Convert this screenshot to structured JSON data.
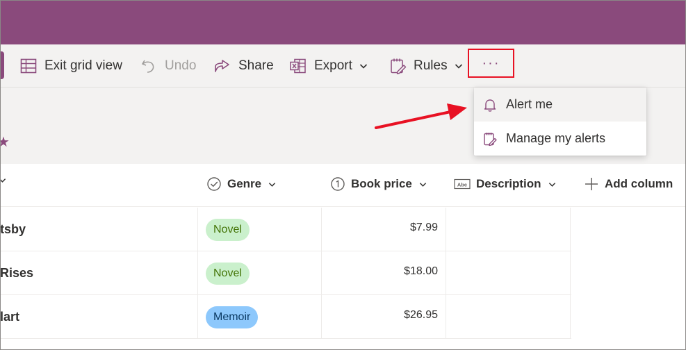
{
  "colors": {
    "brand": "#8a4a7c",
    "highlight_box": "#e81123",
    "annotation_arrow": "#e81123",
    "novel_bg": "#caf0cc",
    "novel_text": "#437406",
    "memoir_bg": "#8dc8fc",
    "memoir_text": "#0b3a63"
  },
  "toolbar": {
    "exit_grid": "Exit grid view",
    "undo": "Undo",
    "share": "Share",
    "export": "Export",
    "rules": "Rules",
    "more": "···"
  },
  "menu": {
    "alert_me": "Alert me",
    "manage_alerts": "Manage my alerts"
  },
  "columns": {
    "genre": "Genre",
    "book_price": "Book price",
    "description": "Description",
    "add_column": "Add column"
  },
  "rows": [
    {
      "title": "tsby",
      "genre": "Novel",
      "price": "$7.99"
    },
    {
      "title": "Rises",
      "genre": "Novel",
      "price": "$18.00"
    },
    {
      "title": "lart",
      "genre": "Memoir",
      "price": "$26.95"
    }
  ]
}
